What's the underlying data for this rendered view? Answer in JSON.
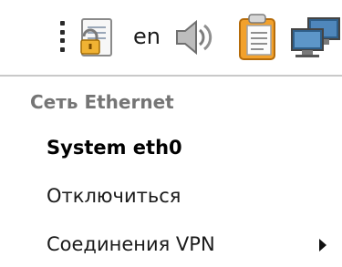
{
  "tray": {
    "keyboard_layout": "en",
    "icons": [
      "notes-lock-icon",
      "volume-icon",
      "clipboard-icon",
      "network-wired-icon"
    ]
  },
  "menu": {
    "header": "Сеть Ethernet",
    "items": [
      {
        "label": "System eth0",
        "active": true
      },
      {
        "label": "Отключиться",
        "active": false
      },
      {
        "label": "Соединения VPN",
        "submenu": true
      }
    ]
  }
}
